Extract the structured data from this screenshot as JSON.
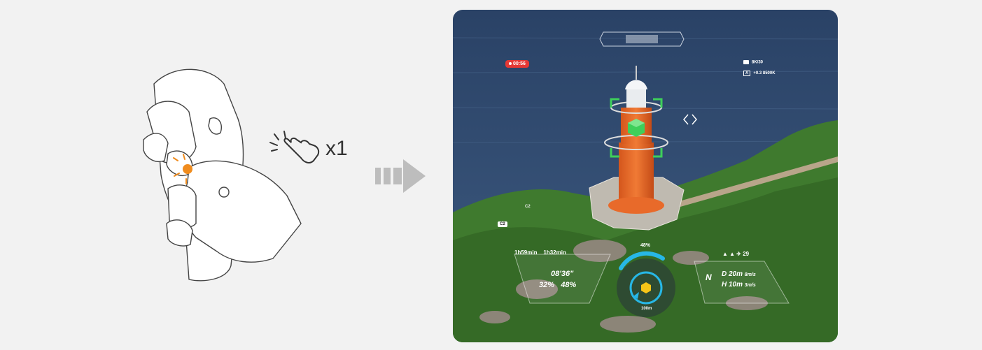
{
  "gesture": {
    "tap_count_label": "x1"
  },
  "hud": {
    "rec_time": "00:56",
    "video_mode": "8K/30",
    "exposure_mode": "A",
    "exposure_values": "+0.3  8500K",
    "camera_tag_primary": "C2",
    "camera_tag_secondary": "C2",
    "remote_battery_time": "1h59min",
    "drone_battery_time": "1h32min",
    "flight_time": "08'36\"",
    "drone_battery_pct": "32%",
    "remote_battery_pct": "48%",
    "signal_status": "29",
    "compass_heading": "N",
    "distance": "D  20m",
    "distance_speed": "8m/s",
    "height": "H  10m",
    "height_speed": "3m/s",
    "gauge_pct": "48%",
    "gauge_distance": "100m"
  },
  "colors": {
    "sea": "#2d4a6e",
    "lighthouse": "#e86a2a",
    "vegetation": "#3f7a2e",
    "rec_red": "#e53935",
    "target_green": "#3ecf5a",
    "gauge_cyan": "#27b7e6",
    "accent_orange": "#f08c1e"
  }
}
